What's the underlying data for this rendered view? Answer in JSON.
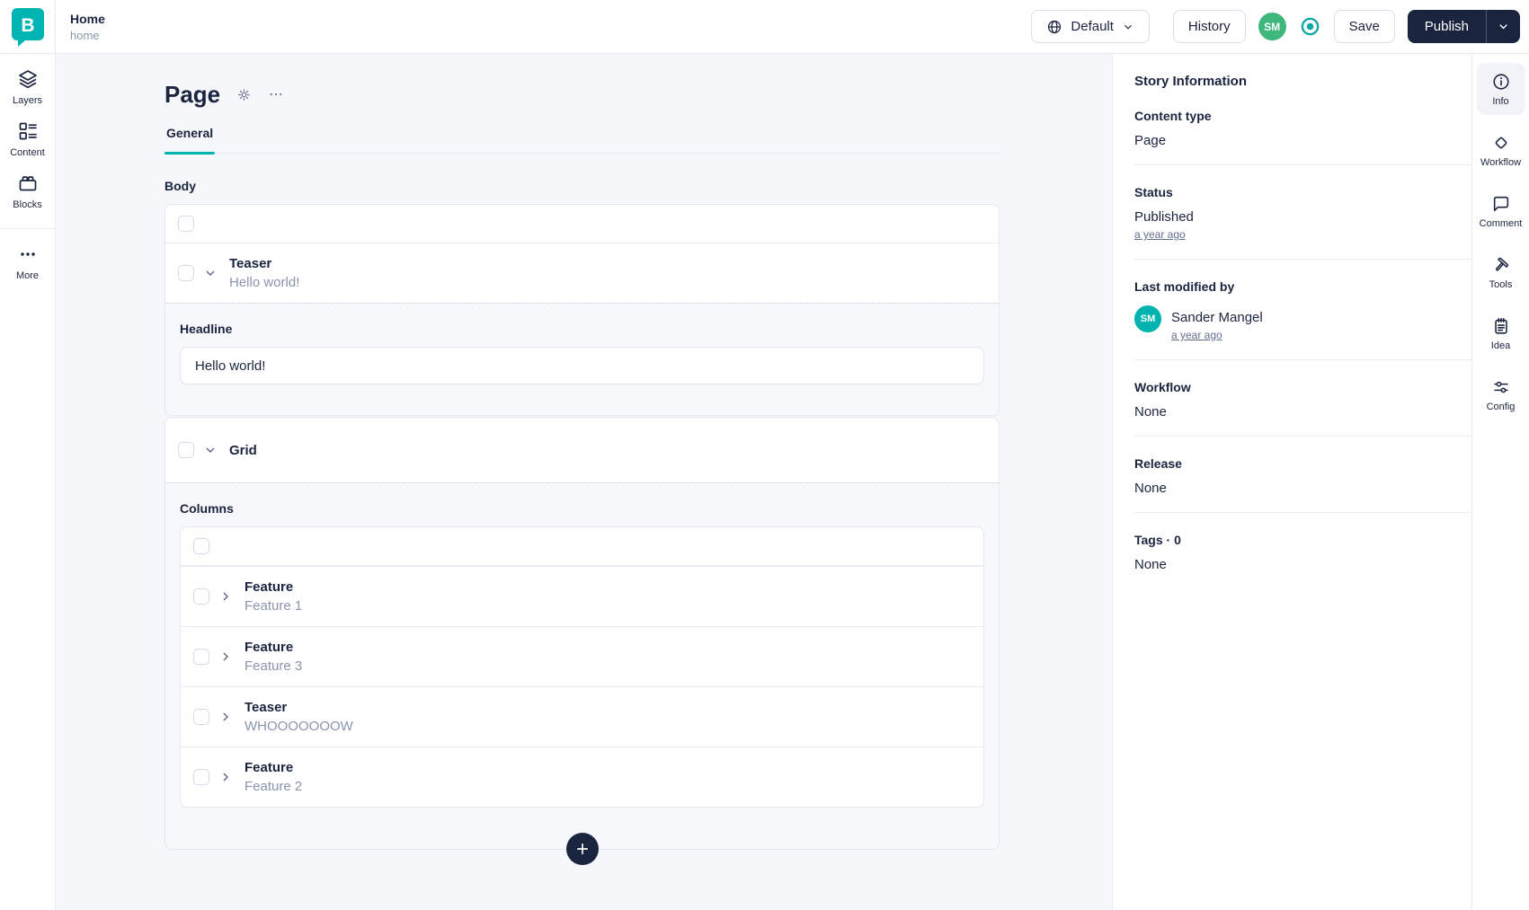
{
  "colors": {
    "accent_teal": "#00b3b0",
    "brand_navy": "#1b243f",
    "avatar_green": "#3eb77d"
  },
  "topbar": {
    "title": "Home",
    "subtitle": "home",
    "language_button": "Default",
    "history_button": "History",
    "avatar_initials": "SM",
    "save_button": "Save",
    "publish_button": "Publish"
  },
  "left_nav": {
    "items": [
      {
        "label": "Layers",
        "icon": "layers-icon"
      },
      {
        "label": "Content",
        "icon": "content-icon"
      },
      {
        "label": "Blocks",
        "icon": "blocks-icon"
      },
      {
        "label": "More",
        "icon": "more-icon"
      }
    ]
  },
  "editor": {
    "page_title": "Page",
    "tab_general": "General",
    "body_label": "Body",
    "teaser_block": {
      "type": "Teaser",
      "preview": "Hello world!"
    },
    "headline": {
      "label": "Headline",
      "value": "Hello world!"
    },
    "grid_block": {
      "type": "Grid"
    },
    "columns_label": "Columns",
    "column_blocks": [
      {
        "type": "Feature",
        "preview": "Feature 1"
      },
      {
        "type": "Feature",
        "preview": "Feature 3"
      },
      {
        "type": "Teaser",
        "preview": "WHOOOOOOOW"
      },
      {
        "type": "Feature",
        "preview": "Feature 2"
      }
    ]
  },
  "story_info": {
    "title": "Story Information",
    "content_type": {
      "label": "Content type",
      "value": "Page"
    },
    "status": {
      "label": "Status",
      "value": "Published",
      "time_link": "a year ago"
    },
    "last_modified": {
      "label": "Last modified by",
      "user": "Sander Mangel",
      "avatar_initials": "SM",
      "time_link": "a year ago"
    },
    "workflow": {
      "label": "Workflow",
      "value": "None"
    },
    "release": {
      "label": "Release",
      "value": "None"
    },
    "tags": {
      "label": "Tags · 0",
      "value": "None"
    }
  },
  "right_rail": {
    "items": [
      {
        "label": "Info",
        "icon": "info-icon"
      },
      {
        "label": "Workflow",
        "icon": "workflow-icon"
      },
      {
        "label": "Comment",
        "icon": "comment-icon"
      },
      {
        "label": "Tools",
        "icon": "tools-icon"
      },
      {
        "label": "Idea",
        "icon": "idea-icon"
      },
      {
        "label": "Config",
        "icon": "config-icon"
      }
    ]
  }
}
